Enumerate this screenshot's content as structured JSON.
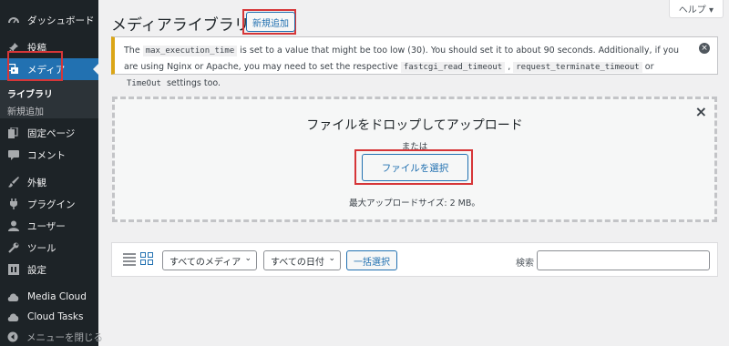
{
  "sidebar": {
    "items": [
      {
        "label": "ダッシュボード",
        "icon": "dashboard-icon"
      },
      {
        "label": "投稿",
        "icon": "pin-icon"
      },
      {
        "label": "メディア",
        "icon": "media-icon"
      },
      {
        "label": "固定ページ",
        "icon": "page-icon"
      },
      {
        "label": "コメント",
        "icon": "comment-icon"
      },
      {
        "label": "外観",
        "icon": "brush-icon"
      },
      {
        "label": "プラグイン",
        "icon": "plugin-icon"
      },
      {
        "label": "ユーザー",
        "icon": "user-icon"
      },
      {
        "label": "ツール",
        "icon": "wrench-icon"
      },
      {
        "label": "設定",
        "icon": "settings-icon"
      },
      {
        "label": "Media Cloud",
        "icon": "cloud-icon"
      },
      {
        "label": "Cloud Tasks",
        "icon": "cloud-icon"
      },
      {
        "label": "メニューを閉じる",
        "icon": "collapse-icon"
      }
    ],
    "submenu": [
      {
        "label": "ライブラリ"
      },
      {
        "label": "新規追加"
      }
    ]
  },
  "header": {
    "title": "メディアライブラリ",
    "add_new_label": "新規追加",
    "help_label": "ヘルプ ▾"
  },
  "notice": {
    "text_1": "The ",
    "code_1": "max_execution_time",
    "text_2": " is set to a value that might be too low (30). You should set it to about 90 seconds. Additionally, if you are using Nginx or Apache, you may need to set the respective ",
    "code_2": "fastcgi_read_timeout",
    "text_3": " , ",
    "code_3": "request_terminate_timeout",
    "text_4": " or ",
    "code_4": "TimeOut",
    "text_5": " settings too.",
    "dismiss": "×"
  },
  "uploader": {
    "close": "×",
    "drop_title": "ファイルをドロップしてアップロード",
    "or": "または",
    "select_files_label": "ファイルを選択",
    "max_size": "最大アップロードサイズ: 2 MB。"
  },
  "toolbar": {
    "media_filter": "すべてのメディア",
    "date_filter": "すべての日付",
    "bulk_select_label": "一括選択",
    "search_label": "検索",
    "search_value": ""
  },
  "colors": {
    "accent": "#2271b1",
    "sidebar_bg": "#1d2327",
    "notice_border": "#dba617",
    "highlight": "#d63638"
  }
}
